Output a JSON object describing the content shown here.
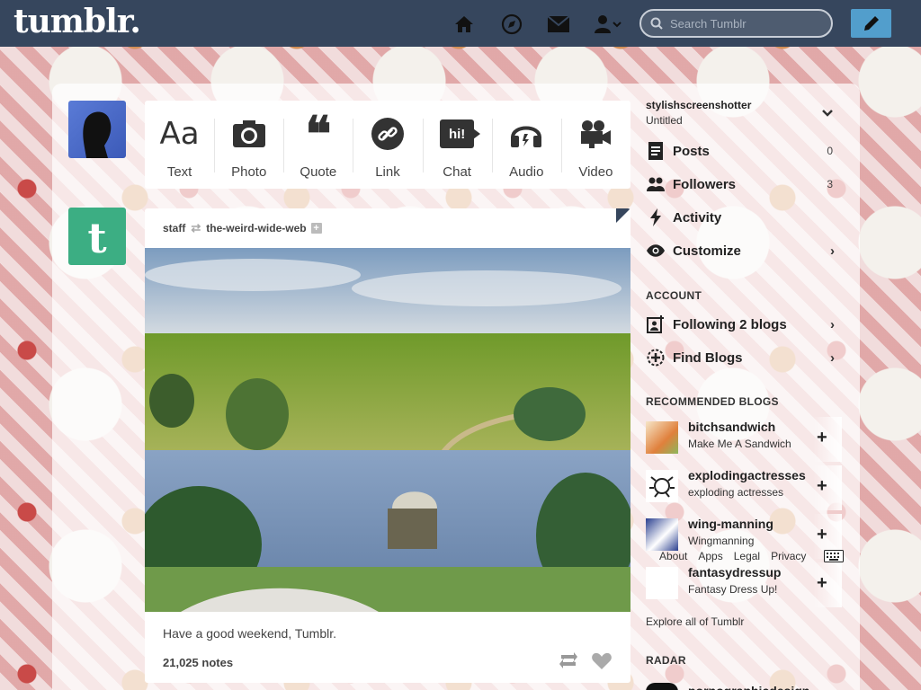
{
  "header": {
    "logo": "tumblr.",
    "search_placeholder": "Search Tumblr",
    "nav": [
      "home-icon",
      "explore-icon",
      "inbox-icon",
      "account-icon"
    ],
    "compose_icon": "pencil-icon",
    "colors": {
      "bar": "#36465d",
      "compose": "#529ecc"
    }
  },
  "post_types": [
    {
      "label": "Text",
      "icon": "text-icon",
      "glyph": "Aa"
    },
    {
      "label": "Photo",
      "icon": "camera-icon"
    },
    {
      "label": "Quote",
      "icon": "quote-icon",
      "glyph": "❝"
    },
    {
      "label": "Link",
      "icon": "link-icon"
    },
    {
      "label": "Chat",
      "icon": "chat-icon",
      "glyph": "hi!"
    },
    {
      "label": "Audio",
      "icon": "headphones-icon"
    },
    {
      "label": "Video",
      "icon": "video-camera-icon"
    }
  ],
  "post": {
    "author": "staff",
    "reblogged_from": "the-weird-wide-web",
    "caption": "Have a good weekend, Tumblr.",
    "notes": "21,025 notes"
  },
  "sidebar": {
    "blog_name": "stylishscreenshotter",
    "blog_title": "Untitled",
    "items": [
      {
        "label": "Posts",
        "count": "0",
        "icon": "posts-icon"
      },
      {
        "label": "Followers",
        "count": "3",
        "icon": "followers-icon"
      },
      {
        "label": "Activity",
        "icon": "activity-icon"
      },
      {
        "label": "Customize",
        "icon": "eye-icon"
      }
    ],
    "account_heading": "ACCOUNT",
    "account_items": [
      {
        "label": "Following 2 blogs",
        "icon": "following-icon"
      },
      {
        "label": "Find Blogs",
        "icon": "find-blogs-icon"
      }
    ],
    "recommended_heading": "RECOMMENDED BLOGS",
    "recommended": [
      {
        "name": "bitchsandwich",
        "title": "Make Me A Sandwich"
      },
      {
        "name": "explodingactresses",
        "title": "exploding actresses"
      },
      {
        "name": "wing-manning",
        "title": "Wingmanning"
      },
      {
        "name": "fantasydressup",
        "title": "Fantasy Dress Up!"
      }
    ],
    "footer_links": [
      "About",
      "Apps",
      "Legal",
      "Privacy"
    ],
    "explore": "Explore all of Tumblr",
    "radar_heading": "RADAR",
    "radar_blog": "pornographicdesign"
  }
}
